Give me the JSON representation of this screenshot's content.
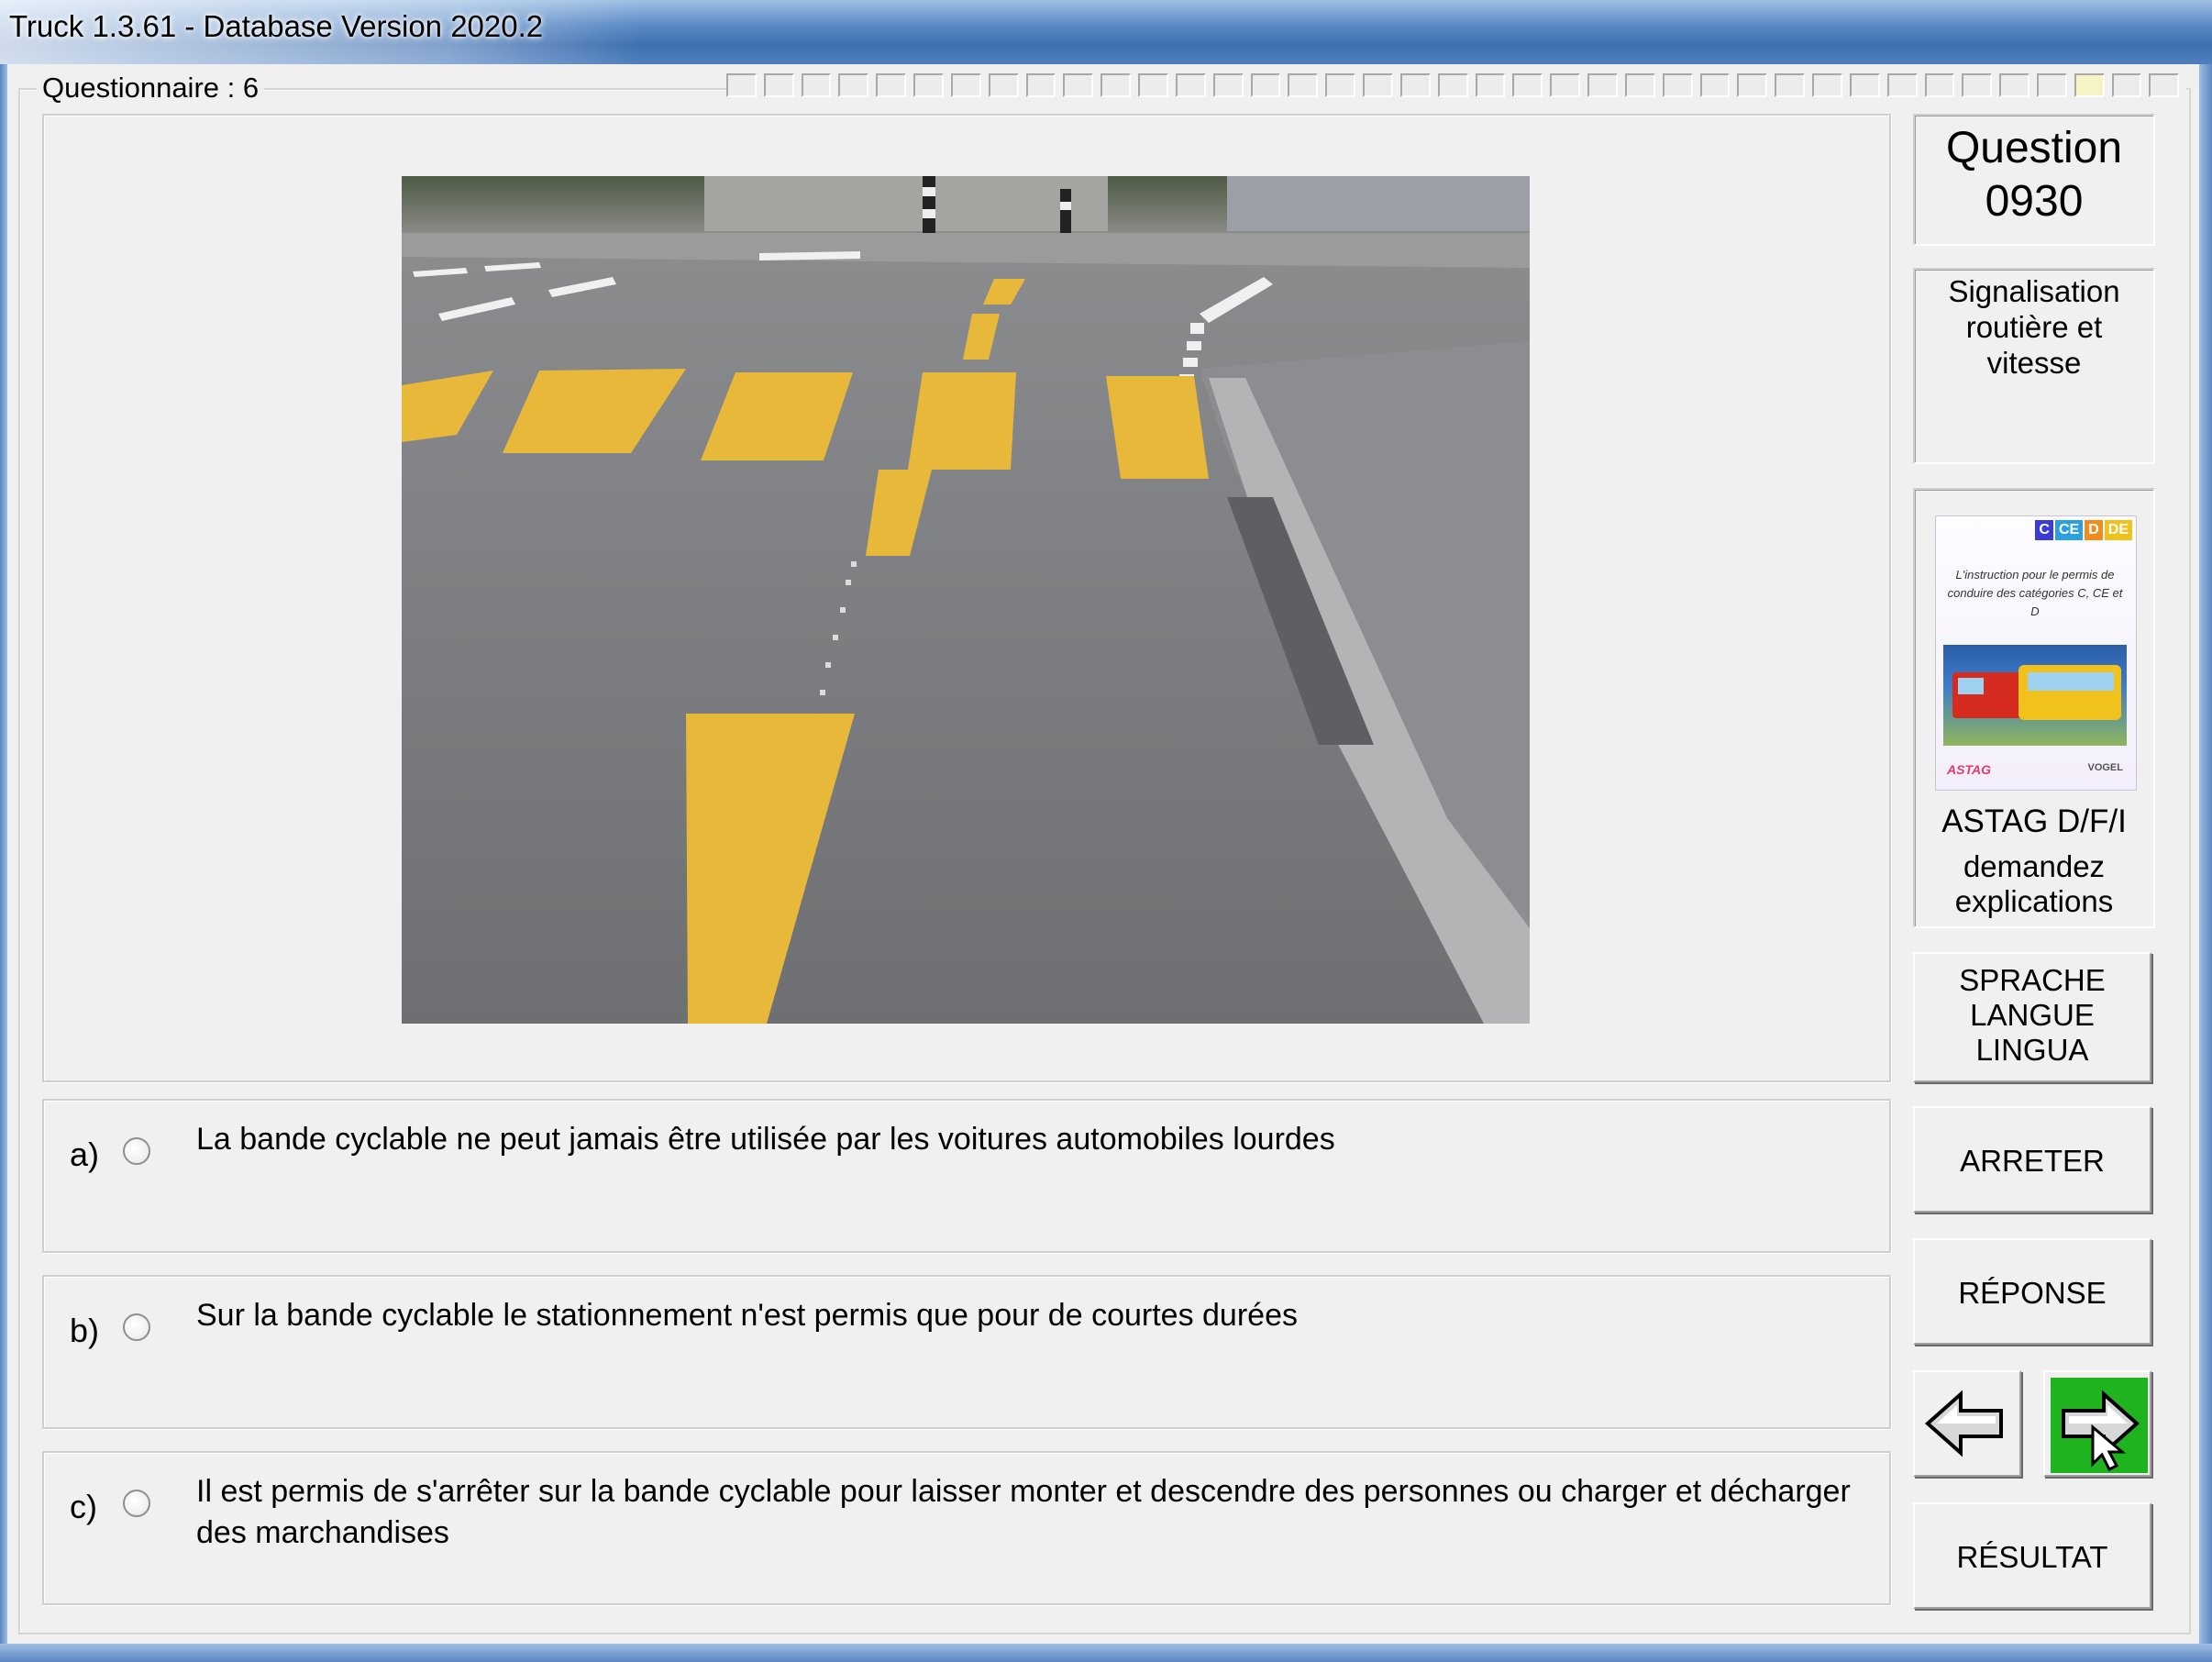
{
  "window": {
    "title": "Truck 1.3.61 - Database Version 2020.2"
  },
  "questionnaire": {
    "label": "Questionnaire : 6",
    "total_slots": 39,
    "done_slots": [
      36
    ]
  },
  "question": {
    "label": "Question",
    "number": "0930"
  },
  "category": {
    "line1": "Signalisation",
    "line2": "routière et vitesse"
  },
  "book": {
    "tags": [
      "C",
      "CE",
      "D",
      "DE"
    ],
    "tag_colors": [
      "#3b3bd6",
      "#2aa0e0",
      "#f08c1c",
      "#f2c21c"
    ],
    "cover_text": "L'instruction pour le permis de conduire des catégories C, CE et D",
    "logo_left": "ASTAG",
    "logo_right": "VOGEL",
    "caption": "ASTAG D/F/I",
    "explanation_line1": "demandez",
    "explanation_line2": "explications"
  },
  "answers": [
    {
      "letter": "a)",
      "text": "La bande cyclable ne peut jamais être utilisée par les voitures automobiles lourdes"
    },
    {
      "letter": "b)",
      "text": "Sur la bande cyclable le stationnement n'est permis que pour de courtes durées"
    },
    {
      "letter": "c)",
      "text": "Il est permis de s'arrêter sur la bande cyclable pour laisser monter et descendre des personnes ou charger et décharger des marchandises"
    }
  ],
  "buttons": {
    "lang1": "SPRACHE",
    "lang2": "LANGUE",
    "lang3": "LINGUA",
    "stop": "ARRETER",
    "answer": "RÉPONSE",
    "result": "RÉSULTAT",
    "prev_icon": "arrow-left-icon",
    "next_icon": "arrow-right-icon"
  },
  "colors": {
    "next_button": "#1fb41f",
    "road_marking": "#e8b83a"
  }
}
